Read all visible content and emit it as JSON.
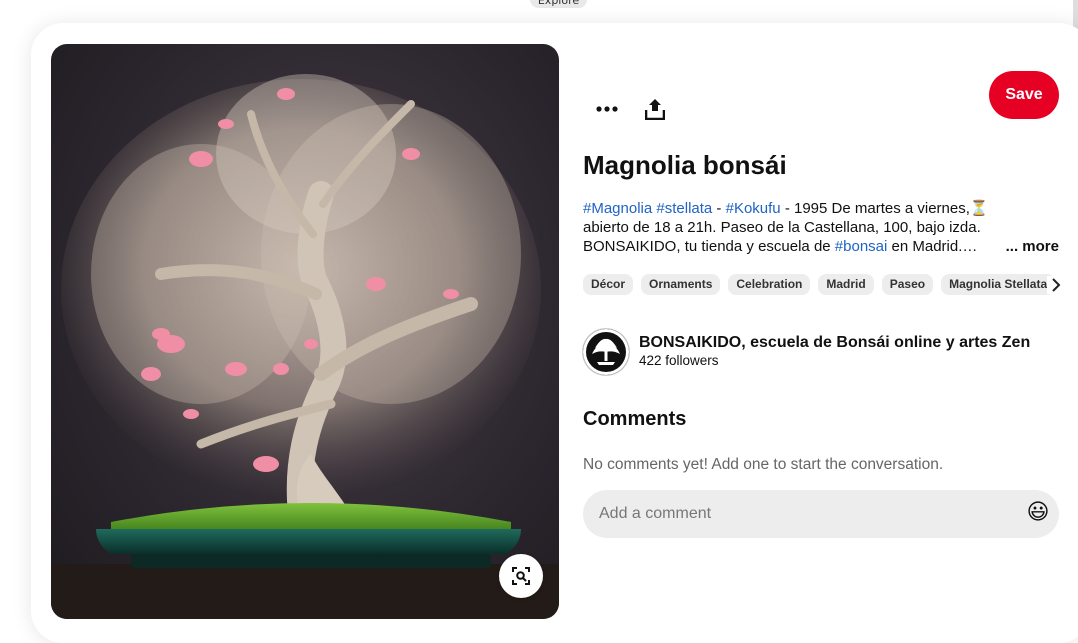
{
  "top_nav": {
    "explore_label": "Explore"
  },
  "pin": {
    "title": "Magnolia bonsái",
    "description": {
      "line1": [
        {
          "text": "#Magnolia",
          "hashtag": true
        },
        {
          "text": " ",
          "hashtag": false
        },
        {
          "text": "#stellata",
          "hashtag": true
        },
        {
          "text": " - ",
          "hashtag": false
        },
        {
          "text": "#Kokufu",
          "hashtag": true
        },
        {
          "text": " - 1995 De martes a viernes,⏳",
          "hashtag": false
        }
      ],
      "line2": "abierto de 18 a 21h. Paseo de la Castellana, 100, bajo izda.",
      "line3_prefix": "BONSAIKIDO, tu tienda y escuela de ",
      "line3_hashtag": "#bonsai",
      "line3_suffix": " en Madrid.…",
      "more_label": "... more"
    },
    "save_label": "Save",
    "actions": {
      "more_icon": "ellipsis-icon",
      "share_icon": "share-upload-icon"
    }
  },
  "tags": [
    "Décor",
    "Ornaments",
    "Celebration",
    "Madrid",
    "Paseo",
    "Magnolia Stellata"
  ],
  "creator": {
    "name": "BONSAIKIDO, escuela de Bonsái online y artes Zen",
    "followers": "422 followers"
  },
  "comments": {
    "heading": "Comments",
    "empty_text": "No comments yet! Add one to start the conversation.",
    "input_placeholder": "Add a comment",
    "emoji": "😃"
  },
  "colors": {
    "save_button": "#e60023",
    "hashtag": "#1f63c4",
    "pill_bg": "#ededed"
  }
}
